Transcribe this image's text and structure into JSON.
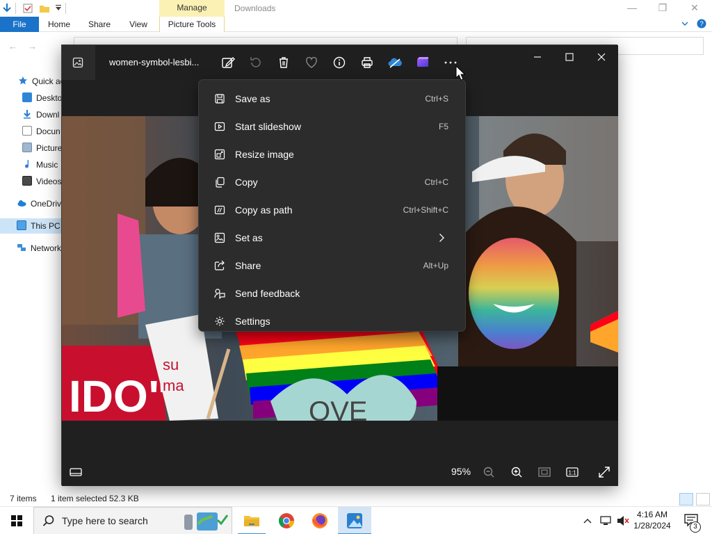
{
  "explorer": {
    "ribbon_tabs": {
      "file": "File",
      "home": "Home",
      "share": "Share",
      "view": "View",
      "picture_tools": "Picture Tools"
    },
    "context_tab": "Manage",
    "window_title": "Downloads",
    "nav_items": [
      {
        "label": "Quick ac",
        "icon": "star-icon"
      },
      {
        "label": "Deskto",
        "icon": "desktop-folder-icon"
      },
      {
        "label": "Downl",
        "icon": "download-folder-icon"
      },
      {
        "label": "Docun",
        "icon": "documents-folder-icon"
      },
      {
        "label": "Picture",
        "icon": "pictures-folder-icon"
      },
      {
        "label": "Music",
        "icon": "music-icon"
      },
      {
        "label": "Videos",
        "icon": "videos-folder-icon"
      },
      {
        "label": "OneDriv",
        "icon": "onedrive-icon"
      },
      {
        "label": "This PC",
        "icon": "this-pc-icon"
      },
      {
        "label": "Network",
        "icon": "network-icon"
      }
    ],
    "status": {
      "items": "7 items",
      "selected": "1 item selected",
      "size": "52.3 KB"
    }
  },
  "photos": {
    "filename": "women-symbol-lesbi...",
    "zoom": "95%"
  },
  "menu": {
    "items": [
      {
        "label": "Save as",
        "shortcut": "Ctrl+S",
        "icon": "save-icon"
      },
      {
        "label": "Start slideshow",
        "shortcut": "F5",
        "icon": "slideshow-icon"
      },
      {
        "label": "Resize image",
        "shortcut": "",
        "icon": "resize-icon"
      },
      {
        "label": "Copy",
        "shortcut": "Ctrl+C",
        "icon": "copy-icon"
      },
      {
        "label": "Copy as path",
        "shortcut": "Ctrl+Shift+C",
        "icon": "copy-path-icon"
      },
      {
        "label": "Set as",
        "shortcut": "",
        "icon": "set-as-icon"
      },
      {
        "label": "Share",
        "shortcut": "Alt+Up",
        "icon": "share-icon"
      },
      {
        "label": "Send feedback",
        "shortcut": "",
        "icon": "feedback-icon"
      },
      {
        "label": "Settings",
        "shortcut": "",
        "icon": "settings-icon"
      }
    ]
  },
  "taskbar": {
    "search_placeholder": "Type here to search",
    "time": "4:16 AM",
    "date": "1/28/2024",
    "notification_count": "3"
  },
  "colors": {
    "accent": "#1a73c8",
    "menu_bg": "#2c2c2c",
    "viewer_bg": "#202020"
  }
}
